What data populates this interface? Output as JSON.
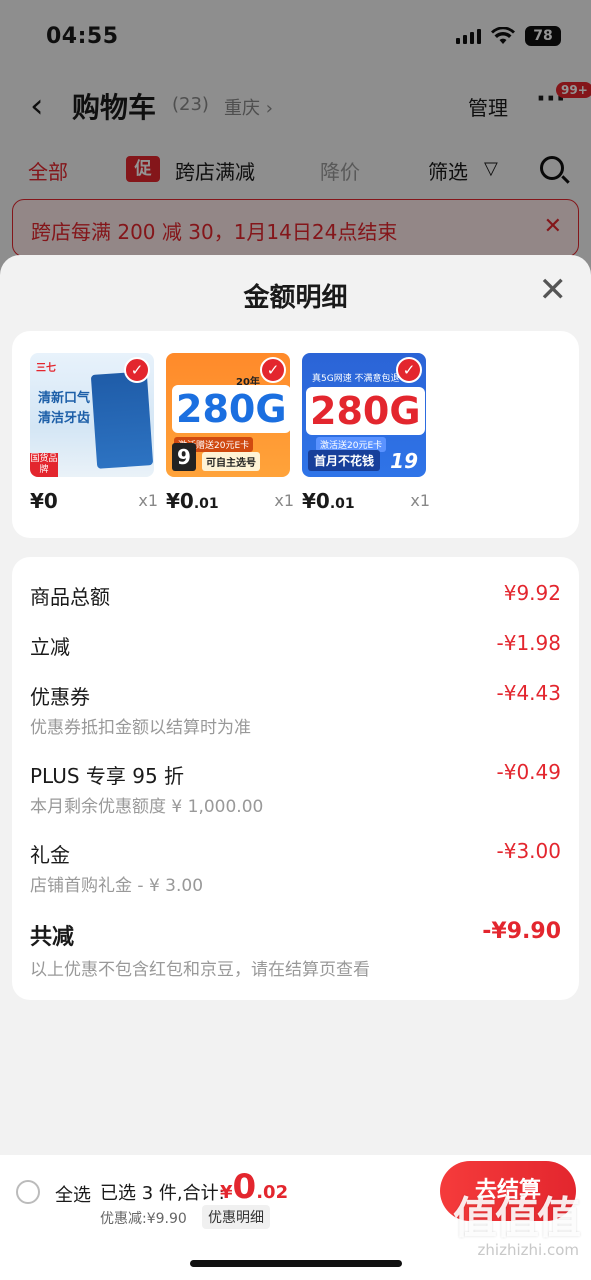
{
  "status": {
    "time": "04:55",
    "battery": "78"
  },
  "nav": {
    "title": "购物车",
    "count": "(23)",
    "city": "重庆 ›",
    "manage": "管理",
    "more": "···",
    "badge": "99+"
  },
  "tabs": {
    "all": "全部",
    "promo_tag": "促",
    "cross_store": "跨店满减",
    "price_drop": "降价",
    "filter": "筛选"
  },
  "banner": {
    "text": "跨店每满 200 减 30，1月14日24点结束"
  },
  "sheet": {
    "title": "金额明细",
    "products": [
      {
        "price": "¥0",
        "qty": "x1",
        "brand": "三七",
        "text1": "清新口气",
        "text2": "清洁牙齿",
        "tag": "国货品牌"
      },
      {
        "price_main": "¥0",
        "price_dec": ".01",
        "qty": "x1",
        "year": "20年",
        "big": "280G",
        "sub": "激活赠送20元E卡",
        "num": "9",
        "pick": "可自主选号"
      },
      {
        "price_main": "¥0",
        "price_dec": ".01",
        "qty": "x1",
        "top": "真5G网速 不满意包退",
        "big": "280G",
        "sub": "激活送20元E卡",
        "bottom": "首月不花钱",
        "corner": "19"
      }
    ],
    "rows": {
      "goods_total": {
        "label": "商品总额",
        "value": "¥9.92"
      },
      "instant": {
        "label": "立减",
        "value": "-¥1.98"
      },
      "coupon": {
        "label": "优惠券",
        "value": "-¥4.43",
        "sub": "优惠券抵扣金额以结算时为准"
      },
      "plus": {
        "label": "PLUS 专享 95 折",
        "value": "-¥0.49",
        "sub": "本月剩余优惠额度 ¥ 1,000.00"
      },
      "gift": {
        "label": "礼金",
        "value": "-¥3.00",
        "sub": "店铺首购礼金 - ¥ 3.00"
      },
      "total": {
        "label": "共减",
        "value": "-¥9.90",
        "sub": "以上优惠不包含红包和京豆，请在结算页查看"
      }
    }
  },
  "bottom": {
    "select_all": "全选",
    "selected": "已选 3 件,合计:",
    "yen": "¥",
    "price_big": "0",
    "price_small": ".02",
    "discount": "优惠减:¥9.90",
    "detail": "优惠明细",
    "checkout": "去结算",
    "watermark_big": "值值值",
    "watermark_small": "zhizhizhi.com"
  },
  "colors": {
    "accent": "#e3262e",
    "sheet_bg": "#f2f2f2"
  }
}
